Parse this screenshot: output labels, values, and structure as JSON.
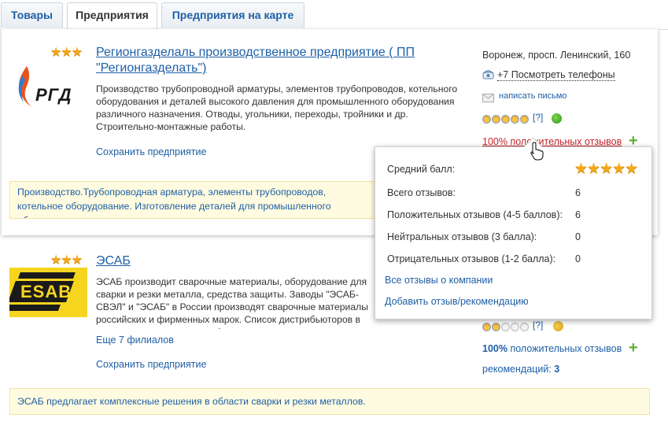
{
  "tabs": [
    {
      "label": "Товары",
      "active": false
    },
    {
      "label": "Предприятия",
      "active": true
    },
    {
      "label": "Предприятия на карте",
      "active": false
    }
  ],
  "listing1": {
    "stars": "★★★",
    "logo_text": "РГД",
    "title": "Регионгазделаль производственное предприятие ( ПП \"Регионгазделать\")",
    "description": "Производство трубопроводной арматуры, элементов трубопроводов, котельного оборудования и деталей высокого давления для промышленного оборудования различного назначения. Отводы, угольники, переходы, тройники и др. Строительно-монтажные работы.",
    "save_link": "Сохранить предприятие",
    "address": "Воронеж, просп. Ленинский, 160",
    "phone_link": "+7 Посмотреть телефоны",
    "mail_link": "написать письмо",
    "rating_help": "[?]",
    "reviews_link": "100% положительных отзывов",
    "note": "Производство.Трубопроводная арматура, элементы трубопроводов, котельное оборудование. Изготовление деталей для промышленного оборудования."
  },
  "listing2": {
    "stars": "★★★",
    "logo_text": "ESAB",
    "title": "ЭСАБ",
    "description": "ЭСАБ производит сварочные материалы, оборудование для сварки и резки металла, средства защиты. Заводы \"ЭСАБ-СВЭЛ\" и \"ЭСАБ\" в России производят сварочные материалы российских и фирменных марок. Список дистрибьюторов в вашем регионе на www.esab.ru",
    "branches_link": "Еще 7 филиалов",
    "save_link": "Сохранить предприятие",
    "rating_help": "[?]",
    "reviews_link_pct": "100%",
    "reviews_link_text": "положительных отзывов",
    "recommendations_label": "рекомендаций:",
    "recommendations_count": "3",
    "note": "ЭСАБ предлагает комплексные решения в области сварки и резки металлов."
  },
  "popup": {
    "avg_label": "Средний балл:",
    "avg_stars": "★★★★★",
    "rows": [
      {
        "label": "Всего отзывов:",
        "value": "6"
      },
      {
        "label": "Положительных отзывов (4-5 баллов):",
        "value": "6"
      },
      {
        "label": "Нейтральных отзывов (3 балла):",
        "value": "0"
      },
      {
        "label": "Отрицательных отзывов (1-2 балла):",
        "value": "0"
      }
    ],
    "all_reviews_link": "Все отзывы о компании",
    "add_review_link": "Добавить отзыв/рекомендацию"
  },
  "colors": {
    "link": "#1e5fa6",
    "reviews_red": "#c8252b",
    "note_bg": "#fffbe0",
    "star": "#f2a91d"
  }
}
